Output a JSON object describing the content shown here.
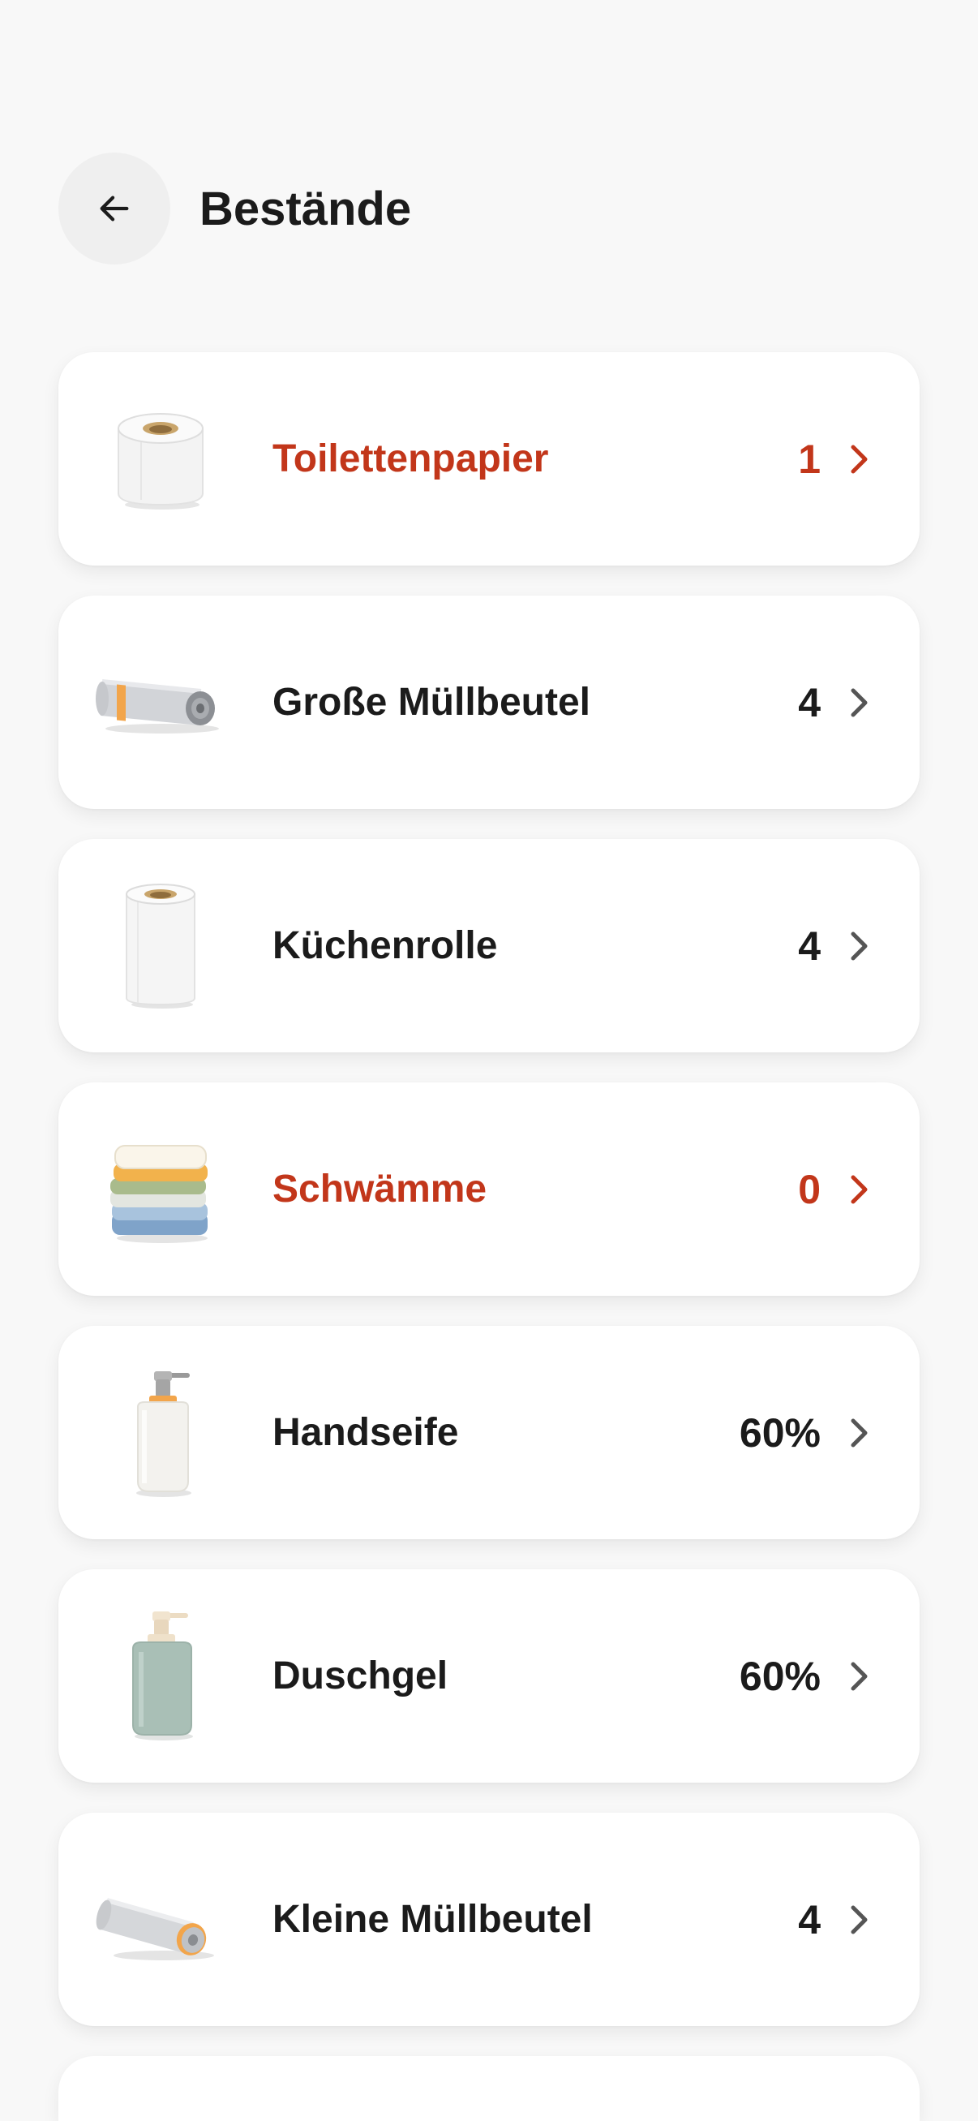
{
  "header": {
    "title": "Bestände"
  },
  "colors": {
    "background": "#f8f8f8",
    "card": "#ffffff",
    "alert": "#c2361a",
    "text": "#1b1b1b",
    "back_button_bg": "#efefef"
  },
  "items": [
    {
      "label": "Toilettenpapier",
      "count": "1",
      "alert": true,
      "icon": "toilet-paper-icon"
    },
    {
      "label": "Große Müllbeutel",
      "count": "4",
      "alert": false,
      "icon": "large-trash-bags-icon"
    },
    {
      "label": "Küchenrolle",
      "count": "4",
      "alert": false,
      "icon": "kitchen-roll-icon"
    },
    {
      "label": "Schwämme",
      "count": "0",
      "alert": true,
      "icon": "sponges-icon"
    },
    {
      "label": "Handseife",
      "count": "60%",
      "alert": false,
      "icon": "hand-soap-icon"
    },
    {
      "label": "Duschgel",
      "count": "60%",
      "alert": false,
      "icon": "shower-gel-icon"
    },
    {
      "label": "Kleine Müllbeutel",
      "count": "4",
      "alert": false,
      "icon": "small-trash-bags-icon"
    }
  ]
}
